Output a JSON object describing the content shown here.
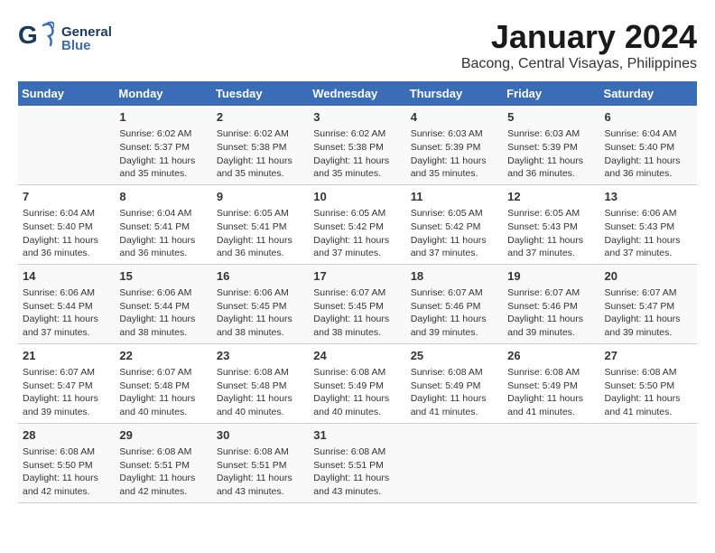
{
  "header": {
    "logo": {
      "general": "General",
      "blue": "Blue"
    },
    "title": "January 2024",
    "location": "Bacong, Central Visayas, Philippines"
  },
  "calendar": {
    "days": [
      "Sunday",
      "Monday",
      "Tuesday",
      "Wednesday",
      "Thursday",
      "Friday",
      "Saturday"
    ],
    "weeks": [
      [
        {
          "day": "",
          "content": ""
        },
        {
          "day": "1",
          "content": "Sunrise: 6:02 AM\nSunset: 5:37 PM\nDaylight: 11 hours\nand 35 minutes."
        },
        {
          "day": "2",
          "content": "Sunrise: 6:02 AM\nSunset: 5:38 PM\nDaylight: 11 hours\nand 35 minutes."
        },
        {
          "day": "3",
          "content": "Sunrise: 6:02 AM\nSunset: 5:38 PM\nDaylight: 11 hours\nand 35 minutes."
        },
        {
          "day": "4",
          "content": "Sunrise: 6:03 AM\nSunset: 5:39 PM\nDaylight: 11 hours\nand 35 minutes."
        },
        {
          "day": "5",
          "content": "Sunrise: 6:03 AM\nSunset: 5:39 PM\nDaylight: 11 hours\nand 36 minutes."
        },
        {
          "day": "6",
          "content": "Sunrise: 6:04 AM\nSunset: 5:40 PM\nDaylight: 11 hours\nand 36 minutes."
        }
      ],
      [
        {
          "day": "7",
          "content": "Sunrise: 6:04 AM\nSunset: 5:40 PM\nDaylight: 11 hours\nand 36 minutes."
        },
        {
          "day": "8",
          "content": "Sunrise: 6:04 AM\nSunset: 5:41 PM\nDaylight: 11 hours\nand 36 minutes."
        },
        {
          "day": "9",
          "content": "Sunrise: 6:05 AM\nSunset: 5:41 PM\nDaylight: 11 hours\nand 36 minutes."
        },
        {
          "day": "10",
          "content": "Sunrise: 6:05 AM\nSunset: 5:42 PM\nDaylight: 11 hours\nand 37 minutes."
        },
        {
          "day": "11",
          "content": "Sunrise: 6:05 AM\nSunset: 5:42 PM\nDaylight: 11 hours\nand 37 minutes."
        },
        {
          "day": "12",
          "content": "Sunrise: 6:05 AM\nSunset: 5:43 PM\nDaylight: 11 hours\nand 37 minutes."
        },
        {
          "day": "13",
          "content": "Sunrise: 6:06 AM\nSunset: 5:43 PM\nDaylight: 11 hours\nand 37 minutes."
        }
      ],
      [
        {
          "day": "14",
          "content": "Sunrise: 6:06 AM\nSunset: 5:44 PM\nDaylight: 11 hours\nand 37 minutes."
        },
        {
          "day": "15",
          "content": "Sunrise: 6:06 AM\nSunset: 5:44 PM\nDaylight: 11 hours\nand 38 minutes."
        },
        {
          "day": "16",
          "content": "Sunrise: 6:06 AM\nSunset: 5:45 PM\nDaylight: 11 hours\nand 38 minutes."
        },
        {
          "day": "17",
          "content": "Sunrise: 6:07 AM\nSunset: 5:45 PM\nDaylight: 11 hours\nand 38 minutes."
        },
        {
          "day": "18",
          "content": "Sunrise: 6:07 AM\nSunset: 5:46 PM\nDaylight: 11 hours\nand 39 minutes."
        },
        {
          "day": "19",
          "content": "Sunrise: 6:07 AM\nSunset: 5:46 PM\nDaylight: 11 hours\nand 39 minutes."
        },
        {
          "day": "20",
          "content": "Sunrise: 6:07 AM\nSunset: 5:47 PM\nDaylight: 11 hours\nand 39 minutes."
        }
      ],
      [
        {
          "day": "21",
          "content": "Sunrise: 6:07 AM\nSunset: 5:47 PM\nDaylight: 11 hours\nand 39 minutes."
        },
        {
          "day": "22",
          "content": "Sunrise: 6:07 AM\nSunset: 5:48 PM\nDaylight: 11 hours\nand 40 minutes."
        },
        {
          "day": "23",
          "content": "Sunrise: 6:08 AM\nSunset: 5:48 PM\nDaylight: 11 hours\nand 40 minutes."
        },
        {
          "day": "24",
          "content": "Sunrise: 6:08 AM\nSunset: 5:49 PM\nDaylight: 11 hours\nand 40 minutes."
        },
        {
          "day": "25",
          "content": "Sunrise: 6:08 AM\nSunset: 5:49 PM\nDaylight: 11 hours\nand 41 minutes."
        },
        {
          "day": "26",
          "content": "Sunrise: 6:08 AM\nSunset: 5:49 PM\nDaylight: 11 hours\nand 41 minutes."
        },
        {
          "day": "27",
          "content": "Sunrise: 6:08 AM\nSunset: 5:50 PM\nDaylight: 11 hours\nand 41 minutes."
        }
      ],
      [
        {
          "day": "28",
          "content": "Sunrise: 6:08 AM\nSunset: 5:50 PM\nDaylight: 11 hours\nand 42 minutes."
        },
        {
          "day": "29",
          "content": "Sunrise: 6:08 AM\nSunset: 5:51 PM\nDaylight: 11 hours\nand 42 minutes."
        },
        {
          "day": "30",
          "content": "Sunrise: 6:08 AM\nSunset: 5:51 PM\nDaylight: 11 hours\nand 43 minutes."
        },
        {
          "day": "31",
          "content": "Sunrise: 6:08 AM\nSunset: 5:51 PM\nDaylight: 11 hours\nand 43 minutes."
        },
        {
          "day": "",
          "content": ""
        },
        {
          "day": "",
          "content": ""
        },
        {
          "day": "",
          "content": ""
        }
      ]
    ]
  }
}
